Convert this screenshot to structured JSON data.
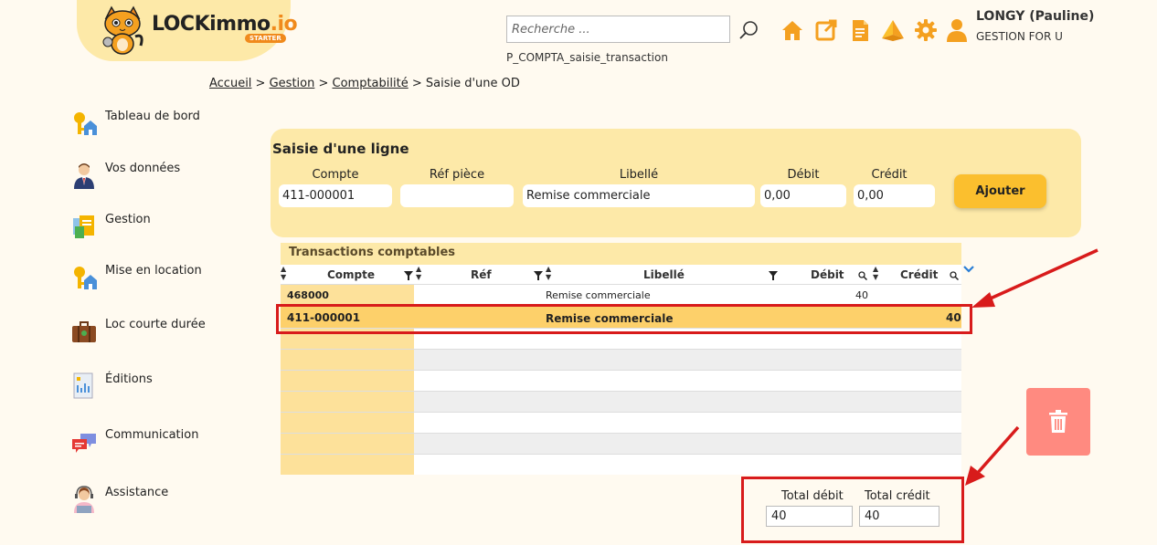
{
  "header": {
    "logo_main": "LOCKimmo",
    "logo_suffix": ".io",
    "logo_badge": "STARTER",
    "search_placeholder": "Recherche ...",
    "page_code": "P_COMPTA_saisie_transaction",
    "icons": [
      "home-icon",
      "external-link-icon",
      "document-icon",
      "pyramid-icon",
      "gear-icon",
      "user-icon"
    ],
    "user_name": "LONGY (Pauline)",
    "user_org": "GESTION FOR U",
    "accent_color": "#f4a020"
  },
  "breadcrumb": {
    "items": [
      "Accueil",
      "Gestion",
      "Comptabilité"
    ],
    "separator": " > ",
    "current": "Saisie d'une OD"
  },
  "sidebar": {
    "items": [
      {
        "label": "Tableau de bord",
        "icon": "keys-house-icon"
      },
      {
        "label": "Vos données",
        "icon": "person-icon"
      },
      {
        "label": "Gestion",
        "icon": "documents-icon"
      },
      {
        "label": "Mise en location",
        "icon": "keys-house-icon"
      },
      {
        "label": "Loc courte durée",
        "icon": "suitcase-icon"
      },
      {
        "label": "Éditions",
        "icon": "report-icon"
      },
      {
        "label": "Communication",
        "icon": "chat-bubbles-icon"
      },
      {
        "label": "Assistance",
        "icon": "support-agent-icon"
      }
    ]
  },
  "entry": {
    "title": "Saisie d'une ligne",
    "columns": [
      "Compte",
      "Réf pièce",
      "Libellé",
      "Débit",
      "Crédit"
    ],
    "values": {
      "compte": "411-000001",
      "ref": "",
      "libelle": "Remise commerciale",
      "debit": "0,00",
      "credit": "0,00"
    },
    "add_label": "Ajouter"
  },
  "table": {
    "title": "Transactions comptables",
    "columns": [
      "Compte",
      "Réf",
      "Libellé",
      "Débit",
      "Crédit"
    ],
    "rows": [
      {
        "compte": "468000",
        "ref": "",
        "libelle": "Remise commerciale",
        "debit": "40",
        "credit": ""
      },
      {
        "compte": "411-000001",
        "ref": "",
        "libelle": "Remise commerciale",
        "debit": "",
        "credit": "40"
      }
    ],
    "selected_row": 1,
    "empty_rows": 7
  },
  "totals": {
    "debit_label": "Total débit",
    "credit_label": "Total crédit",
    "debit_value": "40",
    "credit_value": "40"
  },
  "colors": {
    "panel_bg": "#fde9a8",
    "button": "#fbbf2e",
    "selected_row": "#fdd06a",
    "delete_button": "#ff8a80",
    "highlight": "#d81b1b"
  }
}
